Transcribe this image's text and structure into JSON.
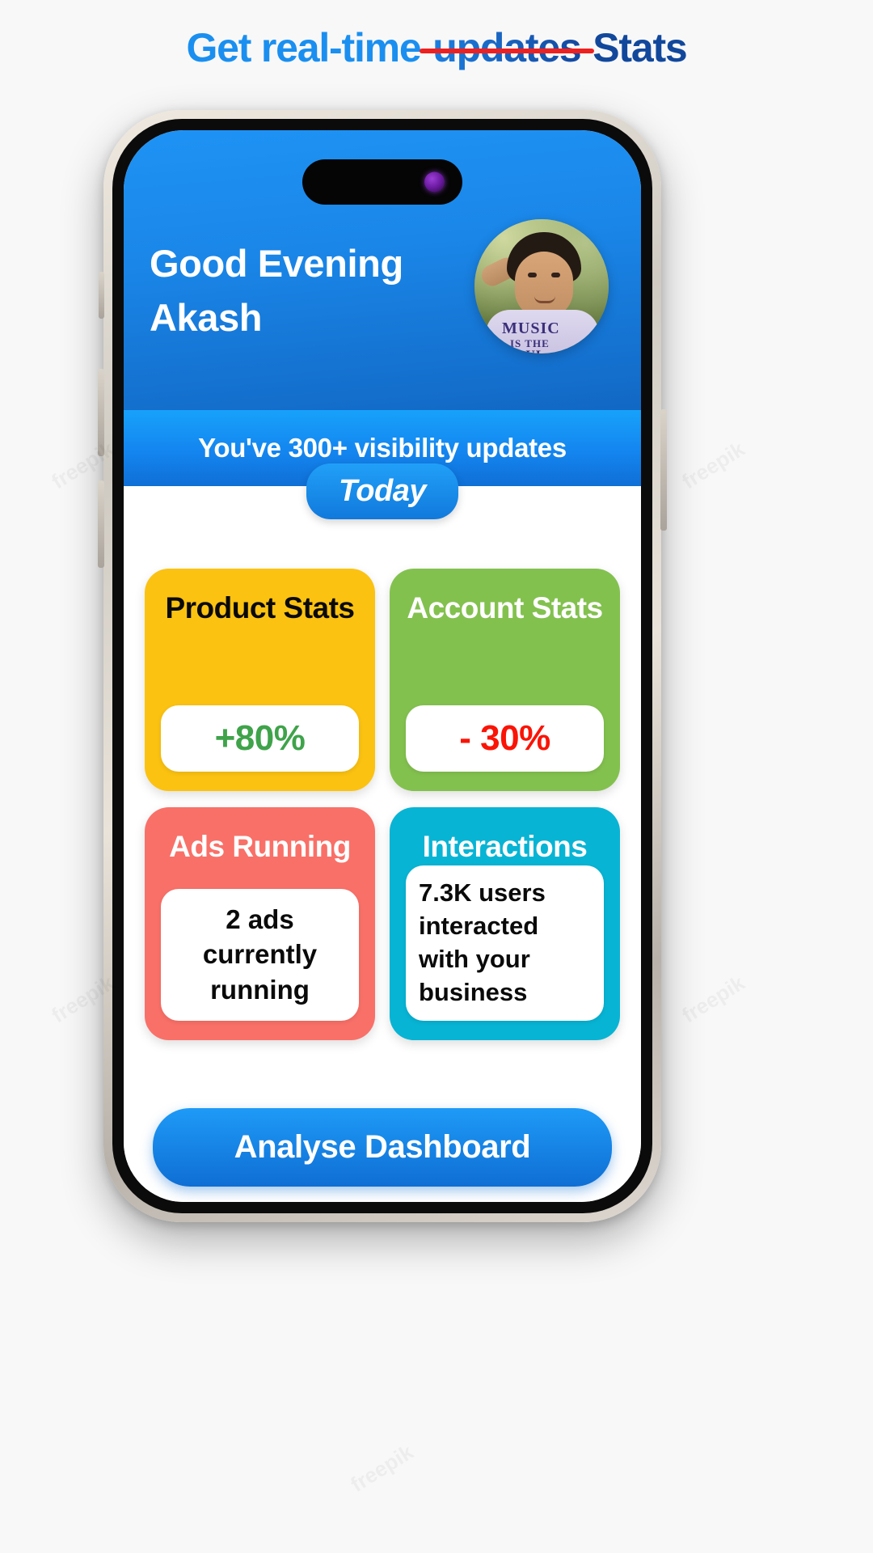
{
  "headline": {
    "part1": "Get real-time",
    "strikethrough": "updates",
    "part3": "Stats",
    "colors": {
      "part1": "#1a8ff0",
      "strikethrough_text": "#14479e",
      "strike_line": "#ef2020",
      "part3": "#11489c"
    }
  },
  "phone": {
    "status_island": "dynamic-island",
    "camera_dot_color": "#8b2fd0"
  },
  "app": {
    "header": {
      "greeting_line1": "Good Evening",
      "greeting_line2": "Akash",
      "avatar_alt": "Akash profile photo",
      "background_color": "#1a86e8"
    },
    "banner": {
      "text": "You've 300+ visibility updates",
      "background_color": "#1485ef"
    },
    "period_pill": {
      "label": "Today",
      "background_color": "#1179dc"
    },
    "cards": [
      {
        "title": "Product Stats",
        "value": "+80%",
        "card_color": "#fbc211",
        "value_color": "#3fa34a",
        "title_color": "#0a0a0a"
      },
      {
        "title": "Account Stats",
        "value": "- 30%",
        "card_color": "#83c14f",
        "value_color": "#fa1406",
        "title_color": "#ffffff"
      },
      {
        "title": "Ads Running",
        "value": "2 ads currently running",
        "card_color": "#f97068",
        "value_color": "#0a0a0a",
        "title_color": "#ffffff"
      },
      {
        "title": "Interactions",
        "value": "7.3K users interacted with your business",
        "card_color": "#08b4d4",
        "value_color": "#0a0a0a",
        "title_color": "#ffffff"
      }
    ],
    "cta": {
      "label": "Analyse Dashboard",
      "background_color": "#0f6ed4"
    }
  }
}
